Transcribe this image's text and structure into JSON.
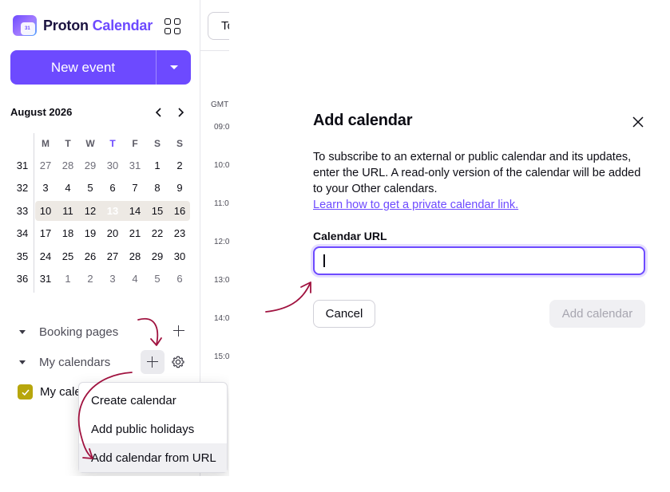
{
  "app": {
    "logo_word1": "Proton",
    "logo_word2": "Calendar",
    "logo_badge": "31"
  },
  "toolbar": {
    "new_event_label": "New event",
    "today_label": "To"
  },
  "mini_calendar": {
    "month_label": "August 2026",
    "weekdays": [
      "M",
      "T",
      "W",
      "T",
      "F",
      "S",
      "S"
    ],
    "today_weekday_index": 3,
    "weeks": [
      {
        "num": "31",
        "days": [
          "27",
          "28",
          "29",
          "30",
          "31",
          "1",
          "2"
        ],
        "muted": [
          true,
          true,
          true,
          true,
          true,
          false,
          false
        ]
      },
      {
        "num": "32",
        "days": [
          "3",
          "4",
          "5",
          "6",
          "7",
          "8",
          "9"
        ],
        "muted": [
          false,
          false,
          false,
          false,
          false,
          false,
          false
        ]
      },
      {
        "num": "33",
        "days": [
          "10",
          "11",
          "12",
          "13",
          "14",
          "15",
          "16"
        ],
        "muted": [
          false,
          false,
          false,
          false,
          false,
          false,
          false
        ],
        "current": true,
        "today_index": 3
      },
      {
        "num": "34",
        "days": [
          "17",
          "18",
          "19",
          "20",
          "21",
          "22",
          "23"
        ],
        "muted": [
          false,
          false,
          false,
          false,
          false,
          false,
          false
        ]
      },
      {
        "num": "35",
        "days": [
          "24",
          "25",
          "26",
          "27",
          "28",
          "29",
          "30"
        ],
        "muted": [
          false,
          false,
          false,
          false,
          false,
          false,
          false
        ]
      },
      {
        "num": "36",
        "days": [
          "31",
          "1",
          "2",
          "3",
          "4",
          "5",
          "6"
        ],
        "muted": [
          false,
          true,
          true,
          true,
          true,
          true,
          true
        ]
      }
    ]
  },
  "sidebar": {
    "booking_label": "Booking pages",
    "my_calendars_label": "My calendars",
    "calendar_item_label": "My cale"
  },
  "timeline": {
    "timezone_label": "GMT",
    "hours": [
      "09:0",
      "10:0",
      "11:0",
      "12:0",
      "13:0",
      "14:0",
      "15:0"
    ]
  },
  "dropdown": {
    "items": [
      "Create calendar",
      "Add public holidays",
      "Add calendar from URL"
    ]
  },
  "modal": {
    "title": "Add calendar",
    "description": "To subscribe to an external or public calendar and its updates, enter the URL. A read-only version of the calendar will be added to your Other calendars.",
    "link_text": "Learn how to get a private calendar link.",
    "field_label": "Calendar URL",
    "url_value": "",
    "cancel_label": "Cancel",
    "submit_label": "Add calendar"
  },
  "colors": {
    "accent": "#6d4aff",
    "calendar_color": "#b7a60c",
    "annotation_arrow": "#a0123f"
  }
}
